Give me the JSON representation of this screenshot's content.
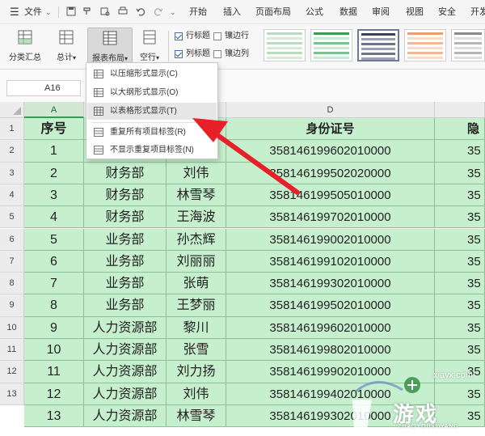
{
  "menubar": {
    "file_label": "文件",
    "tabs": [
      "开始",
      "插入",
      "页面布局",
      "公式",
      "数据",
      "审阅",
      "视图",
      "安全",
      "开发"
    ]
  },
  "ribbon": {
    "subtotal_label": "分类汇总",
    "total_label": "总计",
    "report_layout_label": "报表布局",
    "blank_row_label": "空行",
    "row_header_label": "行标题",
    "banded_rows_label": "镶边行",
    "col_header_label": "列标题",
    "banded_cols_label": "镶边列"
  },
  "namebox": {
    "value": "A16"
  },
  "columns": [
    "A",
    "D"
  ],
  "rows": [
    "1",
    "2",
    "3",
    "4",
    "5",
    "6",
    "7",
    "8",
    "9",
    "10",
    "11",
    "12",
    "13"
  ],
  "table": {
    "header": [
      "序号",
      "",
      "",
      "身份证号",
      "隐"
    ],
    "rows": [
      [
        "1",
        "",
        "",
        "358146199602010000",
        "35"
      ],
      [
        "2",
        "财务部",
        "刘伟",
        "358146199502020000",
        "35"
      ],
      [
        "3",
        "财务部",
        "林雪琴",
        "358146199505010000",
        "35"
      ],
      [
        "4",
        "财务部",
        "王海波",
        "358146199702010000",
        "35"
      ],
      [
        "5",
        "业务部",
        "孙杰辉",
        "358146199002010000",
        "35"
      ],
      [
        "6",
        "业务部",
        "刘丽丽",
        "358146199102010000",
        "35"
      ],
      [
        "7",
        "业务部",
        "张萌",
        "358146199302010000",
        "35"
      ],
      [
        "8",
        "业务部",
        "王梦丽",
        "358146199502010000",
        "35"
      ],
      [
        "9",
        "人力资源部",
        "黎川",
        "358146199602010000",
        "35"
      ],
      [
        "10",
        "人力资源部",
        "张雪",
        "358146199802010000",
        "35"
      ],
      [
        "11",
        "人力资源部",
        "刘力扬",
        "358146199902010000",
        "35"
      ],
      [
        "12",
        "人力资源部",
        "刘伟",
        "358146199402010000",
        "35"
      ],
      [
        "13",
        "人力资源部",
        "林雪琴",
        "358146199302010000",
        "35"
      ]
    ]
  },
  "dropdown": {
    "items": [
      "以压缩形式显示(C)",
      "以大纲形式显示(O)",
      "以表格形式显示(T)",
      "重复所有项目标签(R)",
      "不显示重复项目标签(N)"
    ],
    "highlighted_index": 2
  },
  "watermark": {
    "url": "xiayx.com",
    "word": "游戏",
    "pinyin": "ZHAOYOUXIWANG"
  },
  "colors": {
    "cell_green": "#c6efce",
    "grid_green": "#8dbf98",
    "arrow_red": "#e8202a"
  }
}
